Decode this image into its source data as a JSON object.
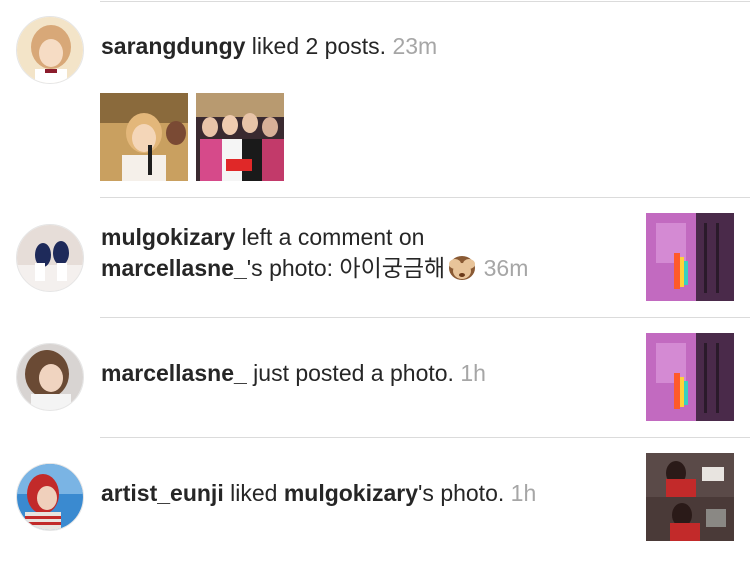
{
  "notifications": [
    {
      "username": "sarangdungy",
      "action": " liked 2 posts. ",
      "time": "23m"
    },
    {
      "username": "mulgokizary",
      "action_line1": " left a comment on",
      "target_user": "marcellasne_",
      "action_line2": "'s photo: ",
      "comment": "아이궁금해",
      "emoji": "see-no-evil-monkey",
      "time": "36m"
    },
    {
      "username": "marcellasne_",
      "action": " just posted a photo. ",
      "time": "1h"
    },
    {
      "username": "artist_eunji",
      "action": " liked ",
      "target_user": "mulgokizary",
      "action_suffix": "'s photo. ",
      "time": "1h"
    }
  ],
  "colors": {
    "text": "#262626",
    "timestamp": "#a6a6a6",
    "divider": "#dbdbdb"
  }
}
